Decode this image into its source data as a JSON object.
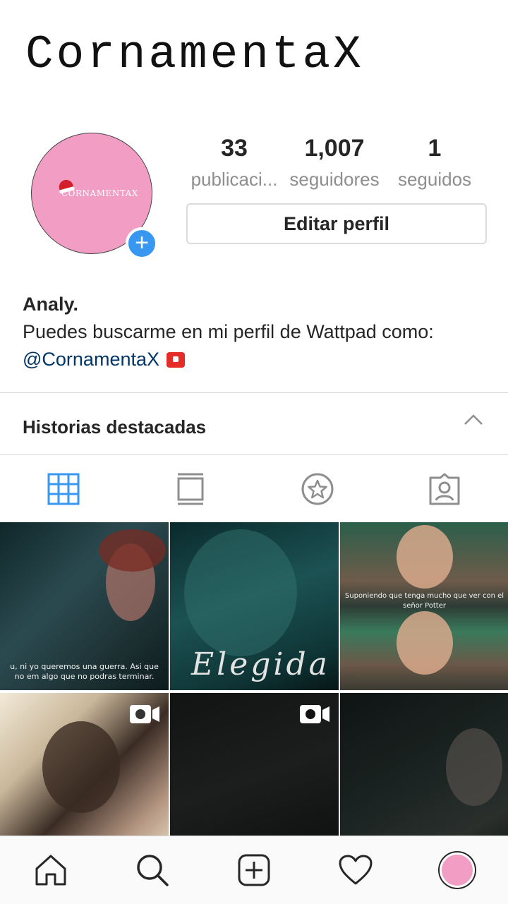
{
  "profile": {
    "username": "CornamentaX",
    "avatar_text": "CORNAMENTAX",
    "stats": [
      {
        "value": "33",
        "label": "publicaci..."
      },
      {
        "value": "1,007",
        "label": "seguidores"
      },
      {
        "value": "1",
        "label": "seguidos"
      }
    ],
    "edit_button": "Editar perfil",
    "bio_name": "Analy.",
    "bio_text": "Puedes buscarme en mi perfil de Wattpad como:",
    "bio_link": "@CornamentaX"
  },
  "highlights": {
    "title": "Historias destacadas"
  },
  "tabs": [
    {
      "icon": "grid-icon",
      "active": true
    },
    {
      "icon": "feed-icon",
      "active": false
    },
    {
      "icon": "star-icon",
      "active": false
    },
    {
      "icon": "tagged-icon",
      "active": false
    }
  ],
  "posts": [
    {
      "caption": "u, ni yo queremos una guerra. Asi que no em algo que no podras terminar."
    },
    {
      "caption": "Elegida"
    },
    {
      "caption": "Suponiendo que tenga mucho que ver con el señor Potter"
    },
    {
      "caption": "",
      "type": "video"
    },
    {
      "caption": "",
      "type": "video"
    },
    {
      "caption": ""
    }
  ],
  "colors": {
    "accent": "#3897f0",
    "avatar_pink": "#f29dc4",
    "link": "#003569",
    "muted": "#8e8e8e"
  }
}
